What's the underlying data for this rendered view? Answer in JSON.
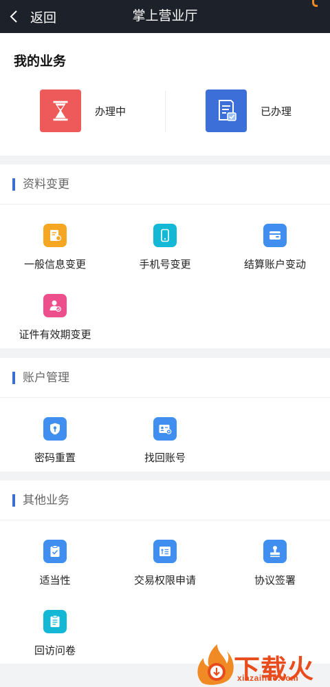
{
  "topbar": {
    "back_label": "返回",
    "title": "掌上营业厅"
  },
  "my_business": {
    "title": "我的业务",
    "items": [
      {
        "label": "办理中",
        "icon": "hourglass-icon",
        "color": "#ee5a5a"
      },
      {
        "label": "已办理",
        "icon": "document-check-icon",
        "color": "#3d6fd8"
      }
    ]
  },
  "sections": [
    {
      "title": "资料变更",
      "items": [
        {
          "label": "一般信息变更",
          "icon": "form-edit-icon",
          "color": "#f5a623"
        },
        {
          "label": "手机号变更",
          "icon": "mobile-phone-icon",
          "color": "#14b8d4"
        },
        {
          "label": "结算账户变动",
          "icon": "wallet-icon",
          "color": "#3f8ef0"
        },
        {
          "label": "证件有效期变更",
          "icon": "user-verified-icon",
          "color": "#ec4f8c"
        }
      ]
    },
    {
      "title": "账户管理",
      "items": [
        {
          "label": "密码重置",
          "icon": "shield-key-icon",
          "color": "#3f8ef0"
        },
        {
          "label": "找回账号",
          "icon": "id-card-icon",
          "color": "#3f8ef0"
        }
      ]
    },
    {
      "title": "其他业务",
      "items": [
        {
          "label": "适当性",
          "icon": "clipboard-check-icon",
          "color": "#3f8ef0"
        },
        {
          "label": "交易权限申请",
          "icon": "permission-list-icon",
          "color": "#3f8ef0"
        },
        {
          "label": "协议签署",
          "icon": "seal-stamp-icon",
          "color": "#3f8ef0"
        },
        {
          "label": "回访问卷",
          "icon": "questionnaire-icon",
          "color": "#14b8d4"
        }
      ]
    }
  ],
  "watermark": {
    "text": "下载火",
    "sub": "xiazaihuo.com",
    "color": "#e84c1c"
  }
}
